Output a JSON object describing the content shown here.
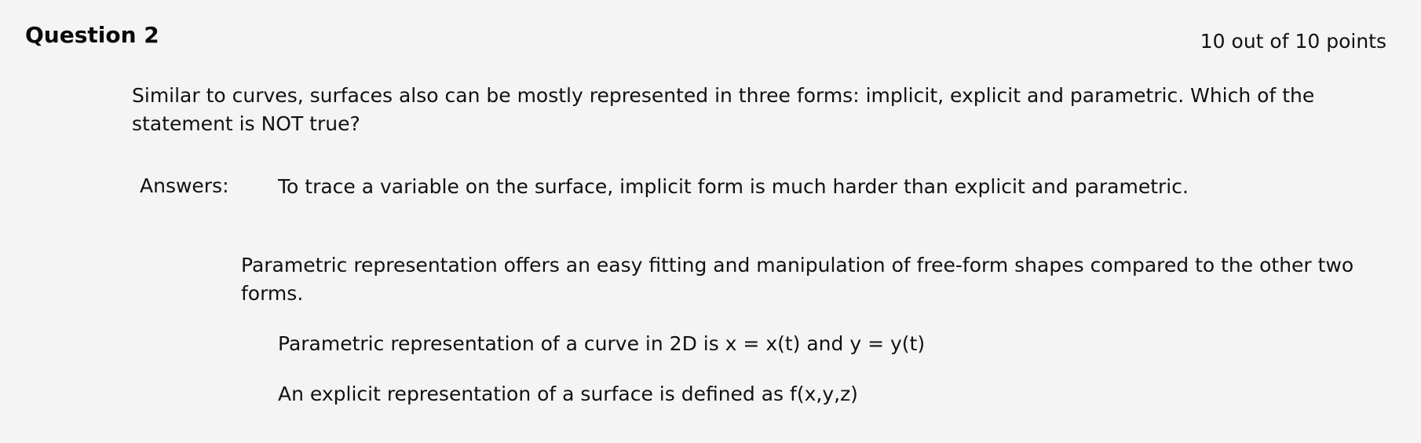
{
  "question": {
    "title": "Question 2",
    "score": "10 out of 10 points",
    "text": "Similar to curves, surfaces also can be mostly represented in three forms: implicit, explicit and parametric. Which of the statement is NOT true?"
  },
  "answers": {
    "label": "Answers:",
    "items": [
      "To trace a variable on the surface, implicit form is much harder than explicit and parametric.",
      "Parametric representation offers an easy fitting and manipulation of free-form shapes compared to the other two forms.",
      "Parametric representation of a curve in 2D is x = x(t) and y = y(t)",
      "An explicit representation of a surface is defined as f(x,y,z)"
    ]
  }
}
